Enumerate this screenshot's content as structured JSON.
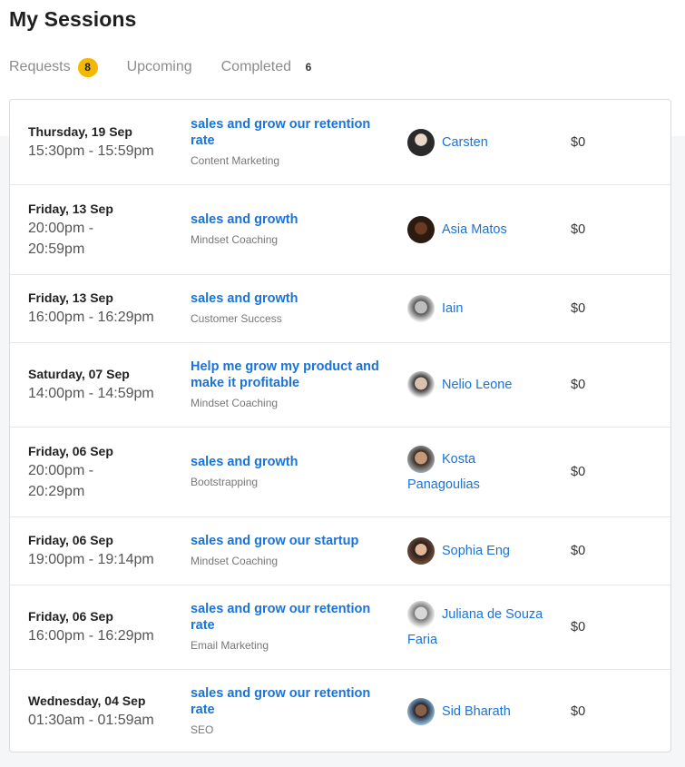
{
  "page": {
    "title": "My Sessions"
  },
  "tabs": [
    {
      "label": "Requests",
      "count": "8",
      "active": true
    },
    {
      "label": "Upcoming",
      "count": ""
    },
    {
      "label": "Completed",
      "count": "6"
    }
  ],
  "sessions": [
    {
      "day": "Thursday, 19 Sep",
      "time": "15:30pm - 15:59pm",
      "title": "sales and grow our retention rate",
      "category": "Content Marketing",
      "mentor": "Carsten",
      "price": "$0"
    },
    {
      "day": "Friday, 13 Sep",
      "time": "20:00pm - 20:59pm",
      "title": "sales and growth",
      "category": "Mindset Coaching",
      "mentor": "Asia Matos",
      "price": "$0"
    },
    {
      "day": "Friday, 13 Sep",
      "time": "16:00pm - 16:29pm",
      "title": "sales and growth",
      "category": "Customer Success",
      "mentor": "Iain",
      "price": "$0"
    },
    {
      "day": "Saturday, 07 Sep",
      "time": "14:00pm - 14:59pm",
      "title": "Help me grow my product and make it profitable",
      "category": "Mindset Coaching",
      "mentor": "Nelio Leone",
      "price": "$0"
    },
    {
      "day": "Friday, 06 Sep",
      "time": "20:00pm - 20:29pm",
      "title": "sales and growth",
      "category": "Bootstrapping",
      "mentor": "Kosta Panagoulias",
      "price": "$0"
    },
    {
      "day": "Friday, 06 Sep",
      "time": "19:00pm - 19:14pm",
      "title": "sales and grow our startup",
      "category": "Mindset Coaching",
      "mentor": "Sophia Eng",
      "price": "$0"
    },
    {
      "day": "Friday, 06 Sep",
      "time": "16:00pm - 16:29pm",
      "title": "sales and grow our retention rate",
      "category": "Email Marketing",
      "mentor": "Juliana de Souza Faria",
      "price": "$0"
    },
    {
      "day": "Wednesday, 04 Sep",
      "time": "01:30am - 01:59am",
      "title": "sales and grow our retention rate",
      "category": "SEO",
      "mentor": "Sid Bharath",
      "price": "$0"
    }
  ],
  "colors": {
    "link": "#1a73d9",
    "badge": "#f5b800"
  },
  "icons": {
    "avatar": "avatar-photo"
  }
}
